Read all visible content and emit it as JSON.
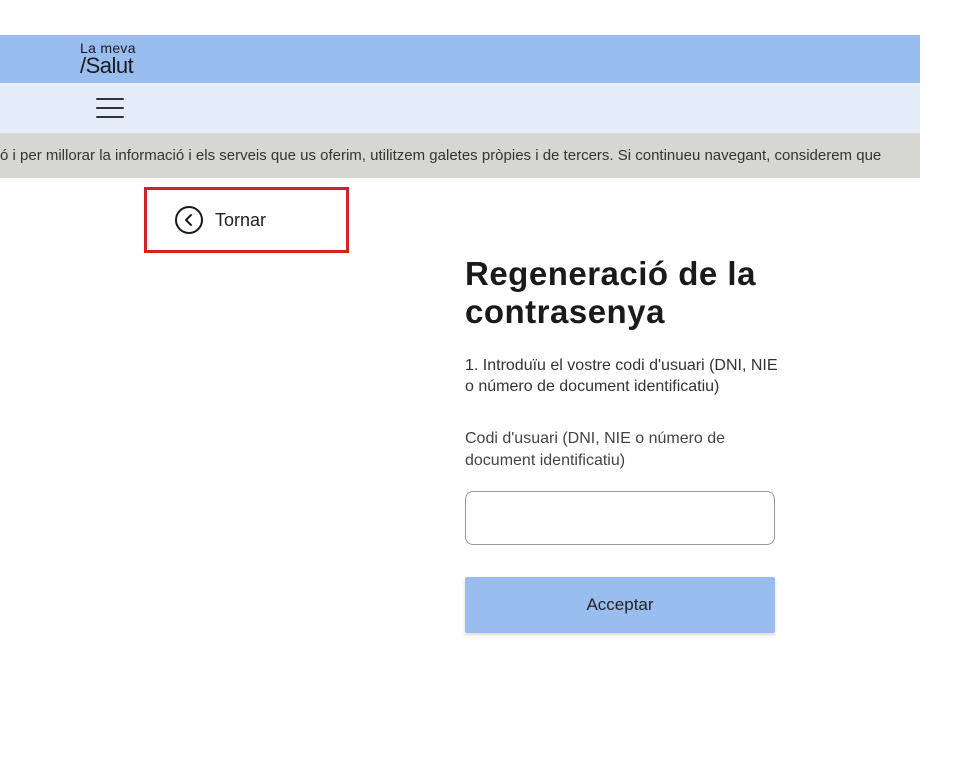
{
  "header": {
    "logo_top": "La meva",
    "logo_bottom": "/Salut"
  },
  "cookie_bar": {
    "text": "ó i per millorar la informació i els serveis que us oferim, utilitzem galetes pròpies i de tercers. Si continueu navegant, considerem que"
  },
  "back": {
    "label": "Tornar"
  },
  "form": {
    "title": "Regeneració de la contrasenya",
    "instruction": "1. Introduïu el vostre codi d'usuari (DNI, NIE o número de document identificatiu)",
    "field_label": "Codi d'usuari (DNI, NIE o número de document identificatiu)",
    "input_value": "",
    "submit_label": "Acceptar"
  }
}
